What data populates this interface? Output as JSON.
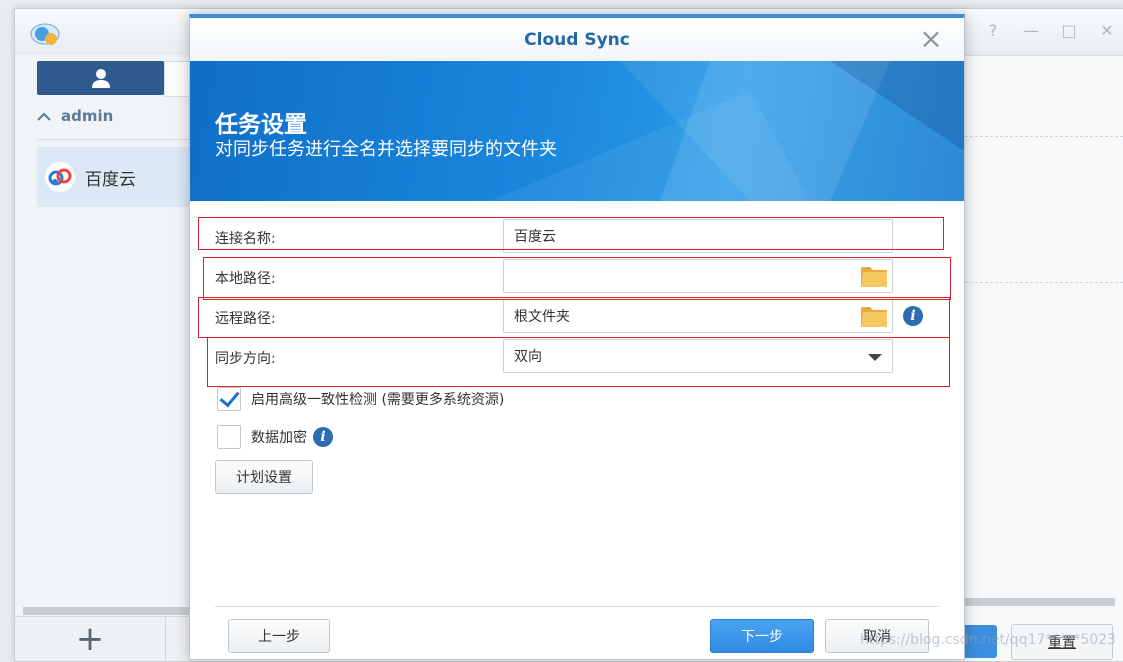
{
  "app": {
    "sidebar": {
      "section": "admin",
      "item": "百度云"
    },
    "bottom": {
      "add_label": "+",
      "reset_label": "重置"
    },
    "window_controls": {
      "help": "?",
      "minimize": "—",
      "maximize": "□",
      "close": "✕"
    },
    "watermark": "https://blog.csdn.net/qq17*****5023"
  },
  "dialog": {
    "title": "Cloud Sync",
    "close": "×",
    "banner": {
      "title": "任务设置",
      "subtitle": "对同步任务进行全名并选择要同步的文件夹"
    },
    "fields": {
      "connection_name": {
        "label": "连接名称:",
        "value": "百度云"
      },
      "local_path": {
        "label": "本地路径:",
        "value": ""
      },
      "remote_path": {
        "label": "远程路径:",
        "value": "根文件夹"
      },
      "sync_direction": {
        "label": "同步方向:",
        "value": "双向"
      }
    },
    "options": {
      "advanced_check": {
        "label": "启用高级一致性检测 (需要更多系统资源)",
        "checked": true
      },
      "encryption": {
        "label": "数据加密",
        "checked": false
      }
    },
    "buttons": {
      "schedule": "计划设置",
      "back": "上一步",
      "next": "下一步",
      "cancel": "取消"
    }
  },
  "colors": {
    "accent": "#2f8ae2",
    "title": "#2468a8",
    "highlight": "#d9232a",
    "folder": "#f0c15a",
    "sidebar_tab": "#2f5a8e"
  }
}
